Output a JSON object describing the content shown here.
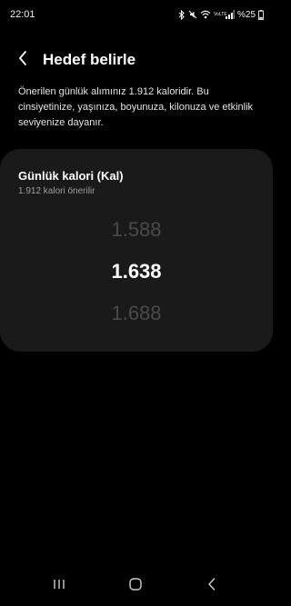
{
  "status_bar": {
    "time": "22:01",
    "battery_text": "%25",
    "network_label": "VoLTE"
  },
  "header": {
    "title": "Hedef belirle"
  },
  "description": "Önerilen günlük alımınız 1.912 kaloridir. Bu cinsiyetinize, yaşınıza, boyunuza, kilonuza ve etkinlik seviyenize dayanır.",
  "card": {
    "title": "Günlük kalori (Kal)",
    "subtitle": "1.912 kalori önerilir",
    "picker": {
      "previous": "1.588",
      "current": "1.638",
      "next": "1.688"
    }
  },
  "colors": {
    "background": "#000000",
    "card": "#1a1a1a",
    "text_primary": "#ffffff",
    "text_secondary": "#9e9e9e",
    "picker_dim": "#4a4a4a"
  },
  "icons": {
    "back": "chevron-left-icon",
    "recents": "recents-icon",
    "home": "home-icon",
    "nav_back": "nav-back-icon"
  }
}
